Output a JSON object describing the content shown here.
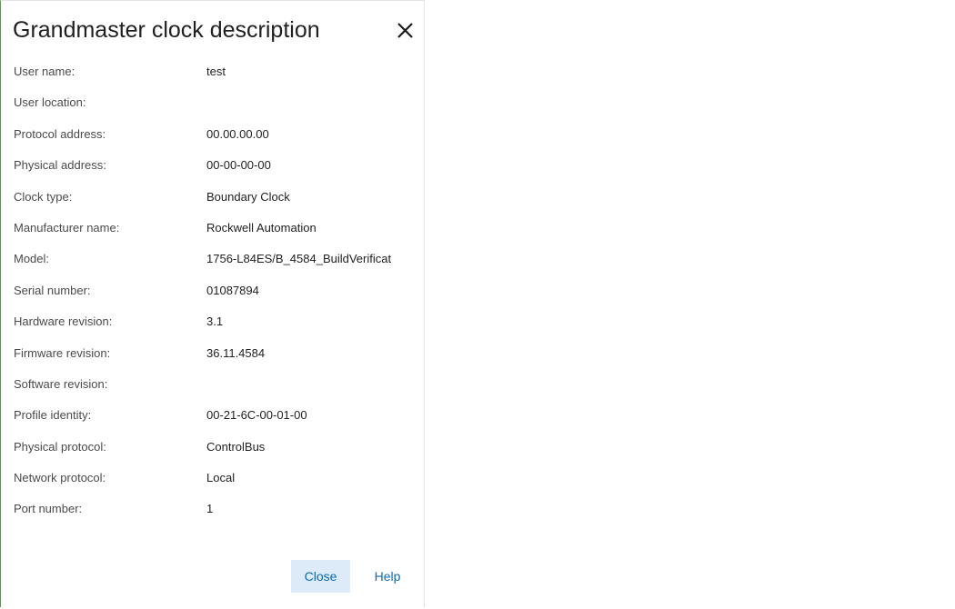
{
  "dialog": {
    "title": "Grandmaster clock description",
    "close_icon": "close-icon"
  },
  "fields": [
    {
      "label": "User name:",
      "value": "test"
    },
    {
      "label": "User location:",
      "value": ""
    },
    {
      "label": "Protocol address:",
      "value": "00.00.00.00"
    },
    {
      "label": "Physical address:",
      "value": "00-00-00-00"
    },
    {
      "label": "Clock type:",
      "value": "Boundary Clock"
    },
    {
      "label": "Manufacturer name:",
      "value": "Rockwell Automation"
    },
    {
      "label": "Model:",
      "value": "1756-L84ES/B_4584_BuildVerificat"
    },
    {
      "label": "Serial number:",
      "value": "01087894"
    },
    {
      "label": "Hardware revision:",
      "value": "3.1"
    },
    {
      "label": "Firmware revision:",
      "value": "36.11.4584"
    },
    {
      "label": "Software revision:",
      "value": ""
    },
    {
      "label": "Profile identity:",
      "value": "00-21-6C-00-01-00"
    },
    {
      "label": "Physical protocol:",
      "value": "ControlBus"
    },
    {
      "label": "Network protocol:",
      "value": "Local"
    },
    {
      "label": "Port number:",
      "value": "1"
    }
  ],
  "footer": {
    "close_label": "Close",
    "help_label": "Help"
  },
  "colors": {
    "accent": "#0b6ab4",
    "close_button_bg": "#dcebf7"
  }
}
